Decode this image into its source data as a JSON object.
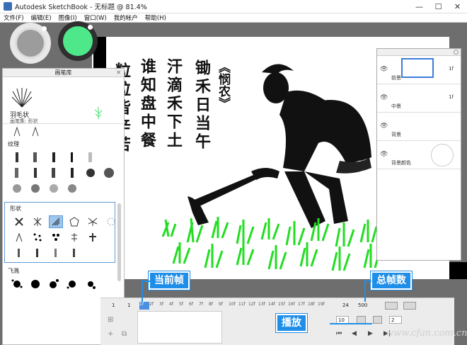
{
  "window": {
    "title": "Autodesk SketchBook - 无标题 @ 81.4%",
    "minimize": "—",
    "maximize": "☐",
    "close": "✕"
  },
  "menu": [
    "文件(F)",
    "编辑(E)",
    "图像(I)",
    "窗口(W)",
    "我的帐户",
    "帮助(H)"
  ],
  "colors": {
    "accent_green": "#4ee88b",
    "callout_blue": "#1f8ee8",
    "selection_blue": "#5b9bd5"
  },
  "brush_library": {
    "title": "画笔库",
    "current_brush_name": "羽毛状",
    "current_brush_set": "画笔集: 形状",
    "sections": [
      "纹理",
      "形状",
      "飞溅"
    ]
  },
  "layers": [
    {
      "name": "前景",
      "frames": "1f"
    },
    {
      "name": "中景",
      "frames": "1f"
    },
    {
      "name": "背景",
      "frames": ""
    },
    {
      "name": "背景颜色",
      "frames": ""
    }
  ],
  "poem": {
    "title": "《悯农》",
    "columns": [
      "锄禾日当午",
      "汗滴禾下土",
      "谁知盘中餐",
      "粒粒皆辛苦"
    ]
  },
  "timeline": {
    "start_frame": "1",
    "current_frame_field": "1",
    "ruler_ticks": [
      "1f",
      "2f",
      "3f",
      "4f",
      "5f",
      "6f",
      "7f",
      "8f",
      "9f",
      "10f",
      "11f",
      "12f",
      "13f",
      "14f",
      "15f",
      "16f",
      "17f",
      "18f",
      "19f"
    ],
    "end_frame": "24",
    "total_frames": "500",
    "fps": "10",
    "step": "2"
  },
  "callouts": {
    "current_frame": "当前帧",
    "total_frames": "总帧数",
    "play": "播放"
  },
  "watermark": "www.cfan.com.cn"
}
